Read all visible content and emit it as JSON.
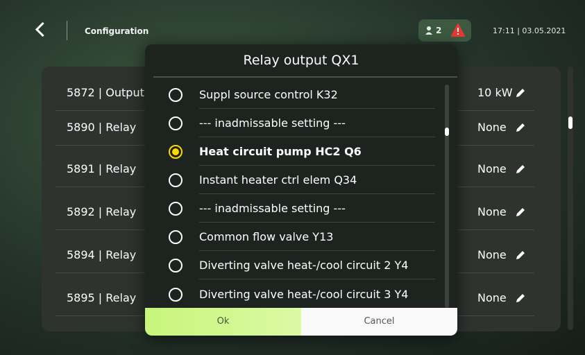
{
  "header": {
    "breadcrumb": "Configuration",
    "user_count": "2",
    "datetime": "17:11 | 03.05.2021"
  },
  "rows": [
    {
      "label": "5872 | Output",
      "value": "10 kW"
    },
    {
      "label": "5890 | Relay",
      "value": "None"
    },
    {
      "label": "5891 | Relay",
      "value": "None"
    },
    {
      "label": "5892 | Relay",
      "value": "None"
    },
    {
      "label": "5894 | Relay",
      "value": "None"
    },
    {
      "label": "5895 | Relay",
      "value": "None"
    }
  ],
  "dialog": {
    "title": "Relay output QX1",
    "options": [
      {
        "label": "Suppl source control K32",
        "selected": false
      },
      {
        "label": "--- inadmissable setting ---",
        "selected": false
      },
      {
        "label": "Heat circuit pump HC2 Q6",
        "selected": true
      },
      {
        "label": "Instant heater ctrl elem Q34",
        "selected": false
      },
      {
        "label": "--- inadmissable setting ---",
        "selected": false
      },
      {
        "label": "Common flow valve Y13",
        "selected": false
      },
      {
        "label": "Diverting valve heat-/cool circuit 2 Y4",
        "selected": false
      },
      {
        "label": "Diverting valve heat-/cool circuit 3 Y4",
        "selected": false
      }
    ],
    "ok_label": "Ok",
    "cancel_label": "Cancel"
  },
  "colors": {
    "accent_yellow": "#ffd800",
    "ok_green": "#c7f57a",
    "alarm_red": "#e53935"
  }
}
